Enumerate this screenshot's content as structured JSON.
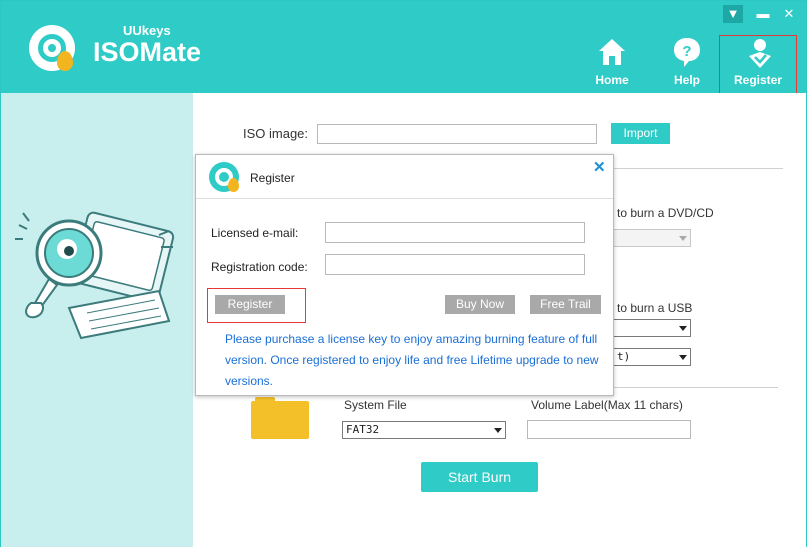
{
  "app": {
    "brand_small": "UUkeys",
    "brand_big": "ISOMate"
  },
  "window_controls": {
    "menu": "▼",
    "minimize": "▬",
    "close": "✕"
  },
  "nav": [
    {
      "label": "Home",
      "icon": "home-icon"
    },
    {
      "label": "Help",
      "icon": "help-icon"
    },
    {
      "label": "Register",
      "icon": "register-icon"
    }
  ],
  "main": {
    "iso_label": "ISO image:",
    "iso_value": "",
    "import_label": "Import",
    "dvd_label": "to burn a DVD/CD",
    "usb_label": "to burn a USB",
    "usb_partial_value": "t)",
    "system_file_label": "System File",
    "system_file_value": "FAT32",
    "volume_label": "Volume Label(Max 11 chars)",
    "volume_value": "",
    "start_burn_label": "Start Burn"
  },
  "dialog": {
    "title": "Register",
    "close": "✕",
    "email_label": "Licensed e-mail:",
    "email_value": "",
    "code_label": "Registration code:",
    "code_value": "",
    "register_button": "Register",
    "buy_now_button": "Buy Now",
    "free_trail_button": "Free Trail",
    "note": "Please purchase a license key to enjoy amazing burning feature of full version. Once registered to enjoy life and free Lifetime upgrade to new versions."
  },
  "colors": {
    "accent": "#2fcbc6",
    "highlight_border": "#e53a3a",
    "note_text": "#1a6fd6",
    "folder": "#f4c02a"
  }
}
